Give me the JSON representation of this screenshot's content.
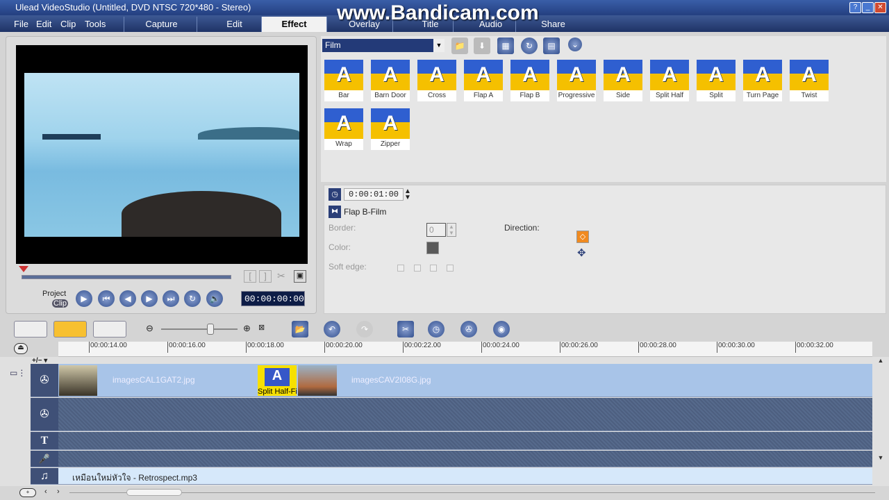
{
  "window": {
    "title": "Ulead VideoStudio (Untitled, DVD NTSC 720*480 - Stereo)",
    "watermark": "www.Bandicam.com",
    "help": "?",
    "minimize": "_",
    "maximize": "□",
    "close": "✕"
  },
  "menu": [
    "File",
    "Edit",
    "Clip",
    "Tools"
  ],
  "tabs": [
    {
      "label": "Capture"
    },
    {
      "label": "Edit"
    },
    {
      "label": "Effect",
      "active": true
    },
    {
      "label": "Overlay"
    },
    {
      "label": "Title"
    },
    {
      "label": "Audio"
    },
    {
      "label": "Share"
    }
  ],
  "preview": {
    "mode_project": "Project",
    "mode_clip": "Clip",
    "timecode": "00:00:00:00",
    "mark_in": "[",
    "mark_out": "]"
  },
  "library": {
    "category": "Film",
    "effects": [
      "Bar",
      "Barn Door",
      "Cross",
      "Flap A",
      "Flap B",
      "Progressive",
      "Side",
      "Split Half",
      "Split",
      "Turn Page",
      "Twist",
      "Wrap",
      "Zipper"
    ],
    "thumb_letter": "A"
  },
  "options": {
    "duration": "0:00:01:00",
    "effect_name": "Flap B-Film",
    "border_label": "Border:",
    "border_value": "0",
    "color_label": "Color:",
    "color_value": "#5a5a5a",
    "soft_edge_label": "Soft edge:",
    "direction_label": "Direction:"
  },
  "timeline": {
    "ruler": [
      "00:00:14.00",
      "00:00:16.00",
      "00:00:18.00",
      "00:00:20.00",
      "00:00:22.00",
      "00:00:24.00",
      "00:00:26.00",
      "00:00:28.00",
      "00:00:30.00",
      "00:00:32.00"
    ],
    "zoom_toggle": "+/− ▾",
    "clip1": "imagesCAL1GAT2.jpg",
    "transition": "Split Half-Film",
    "clip2": "imagesCAV2I08G.jpg",
    "audio": "เหมือนใหม่หัวใจ - Retrospect.mp3",
    "title_track": "T",
    "music_icon": "♫"
  }
}
